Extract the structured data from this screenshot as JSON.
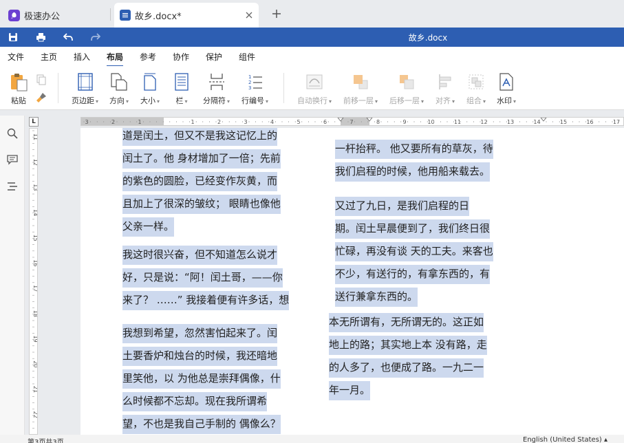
{
  "tabs": {
    "app_label": "极速办公",
    "doc_label": "故乡.docx*"
  },
  "titlebar": {
    "title": "故乡.docx"
  },
  "menu": [
    "文件",
    "主页",
    "插入",
    "布局",
    "参考",
    "协作",
    "保护",
    "组件"
  ],
  "menu_active": "布局",
  "ribbon": {
    "paste": "粘贴",
    "margins": "页边距",
    "orientation": "方向",
    "size": "大小",
    "columns": "栏",
    "breaks": "分隔符",
    "line_numbers": "行编号",
    "wrap": "自动换行",
    "bring_forward": "前移一层",
    "send_backward": "后移一层",
    "align": "对齐",
    "group": "组合",
    "watermark": "水印"
  },
  "hruler_numbers": [
    "3",
    "2",
    "1",
    "1",
    "2",
    "3",
    "4",
    "5",
    "6",
    "7",
    "8",
    "9",
    "10",
    "11",
    "12",
    "13",
    "14",
    "15",
    "16",
    "17"
  ],
  "vruler_numbers": [
    "11",
    "12",
    "13",
    "14",
    "15",
    "16",
    "17",
    "18",
    "19",
    "20",
    "21",
    "22"
  ],
  "document": {
    "left": [
      [
        "道是闰土，但又不是我这记忆上的",
        "闰土了。他 身材增加了一倍；先前",
        "的紫色的圆脸，已经变作灰黄，而",
        "且加上了很深的皱纹； 眼睛也像他",
        "父亲一样。"
      ],
      [
        "我这时很兴奋，但不知道怎么说才",
        "好，只是说：“阿！闰土哥，——你",
        "来了？ ……” 我接着便有许多话，想"
      ],
      [
        "我想到希望，忽然害怕起来了。闰",
        "土要香炉和烛台的时候，我还暗地",
        "里笑他，以 为他总是崇拜偶像，什",
        "么时候都不忘却。现在我所谓希",
        "望，不也是我自己手制的 偶像么？"
      ]
    ],
    "right": [
      [
        "一杆抬秤。 他又要所有的草灰，待",
        "我们启程的时候，他用船来载去。"
      ],
      [
        "又过了九日，是我们启程的日",
        "期。闰土早晨便到了，我们终日很",
        "忙碌，再没有谈 天的工夫。来客也",
        "不少，有送行的，有拿东西的，有",
        "送行兼拿东西的。"
      ],
      [
        "本无所谓有，无所谓无的。这正如",
        "地上的路；其实地上本 没有路，走",
        "的人多了，也便成了路。一九二一",
        "年一月。"
      ]
    ]
  },
  "status": {
    "page_info": "第3页共3页",
    "language": "English (United States)"
  },
  "colors": {
    "brand": "#2d5eb2",
    "selection": "#cdd9ee",
    "app_icon": "#6b3fd1"
  }
}
